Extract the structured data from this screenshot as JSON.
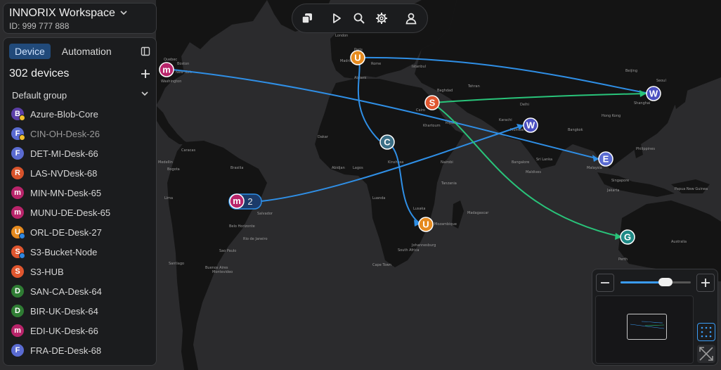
{
  "workspace": {
    "name": "INNORIX Workspace",
    "id": "ID: 999 777 888"
  },
  "tabs": {
    "device": "Device",
    "automation": "Automation"
  },
  "devices_count": "302  devices",
  "group": {
    "label": "Default group"
  },
  "devices": [
    {
      "letter": "B",
      "name": "Azure-Blob-Core",
      "color": "#5c3fa8",
      "dot": "#f2c12e",
      "dim": false
    },
    {
      "letter": "F",
      "name": "CIN-OH-Desk-26",
      "color": "#5a6bd1",
      "dot": "#f2c12e",
      "dim": true
    },
    {
      "letter": "F",
      "name": "DET-MI-Desk-66",
      "color": "#5a6bd1",
      "dot": null,
      "dim": false
    },
    {
      "letter": "R",
      "name": "LAS-NVDesk-68",
      "color": "#d8532b",
      "dot": null,
      "dim": false
    },
    {
      "letter": "m",
      "name": "MIN-MN-Desk-65",
      "color": "#b8246a",
      "dot": null,
      "dim": false
    },
    {
      "letter": "m",
      "name": "MUNU-DE-Desk-65",
      "color": "#b8246a",
      "dot": null,
      "dim": false
    },
    {
      "letter": "U",
      "name": "ORL-DE-Desk-27",
      "color": "#e58a1f",
      "dot": "#2f86e0",
      "dim": false
    },
    {
      "letter": "S",
      "name": "S3-Bucket-Node",
      "color": "#e0562f",
      "dot": "#2f86e0",
      "dim": false
    },
    {
      "letter": "S",
      "name": "S3-HUB",
      "color": "#e0562f",
      "dot": null,
      "dim": false
    },
    {
      "letter": "D",
      "name": "SAN-CA-Desk-64",
      "color": "#2f7d34",
      "dot": null,
      "dim": false
    },
    {
      "letter": "D",
      "name": "BIR-UK-Desk-64",
      "color": "#2f7d34",
      "dot": null,
      "dim": false
    },
    {
      "letter": "m",
      "name": "EDI-UK-Desk-66",
      "color": "#b8246a",
      "dot": null,
      "dim": false
    },
    {
      "letter": "F",
      "name": "FRA-DE-Desk-68",
      "color": "#5a6bd1",
      "dot": null,
      "dim": false
    }
  ],
  "toolbar": {
    "icons": [
      "layers-icon",
      "play-icon",
      "search-icon",
      "gear-icon",
      "user-icon"
    ]
  },
  "zoom": {
    "level": 0.64,
    "minus": "—",
    "plus": "+"
  },
  "map": {
    "labels": [
      {
        "text": "Quebec"
      },
      {
        "text": "Boston"
      },
      {
        "text": "New York"
      },
      {
        "text": "Washington"
      },
      {
        "text": "Caracas"
      },
      {
        "text": "Medellin"
      },
      {
        "text": "Bogota"
      },
      {
        "text": "Lima"
      },
      {
        "text": "Brasilia"
      },
      {
        "text": "Salvador"
      },
      {
        "text": "Belo Horizonte"
      },
      {
        "text": "Rio de Janeiro"
      },
      {
        "text": "Sao Paulo"
      },
      {
        "text": "Santiago"
      },
      {
        "text": "Buenos Aires"
      },
      {
        "text": "Montevideo"
      },
      {
        "text": "London"
      },
      {
        "text": "Paris"
      },
      {
        "text": "Madrid"
      },
      {
        "text": "Rome"
      },
      {
        "text": "Algiers"
      },
      {
        "text": "Istanbul"
      },
      {
        "text": "Cairo"
      },
      {
        "text": "Khartoum"
      },
      {
        "text": "Dakar"
      },
      {
        "text": "Abidjan"
      },
      {
        "text": "Lagos"
      },
      {
        "text": "Kinshasa"
      },
      {
        "text": "Luanda"
      },
      {
        "text": "Nairobi"
      },
      {
        "text": "Lusaka"
      },
      {
        "text": "Johannesburg"
      },
      {
        "text": "Cape Town"
      },
      {
        "text": "Riyadh"
      },
      {
        "text": "Tehran"
      },
      {
        "text": "Baghdad"
      },
      {
        "text": "Karachi"
      },
      {
        "text": "Mumbai"
      },
      {
        "text": "Delhi"
      },
      {
        "text": "Bangalore"
      },
      {
        "text": "Sri Lanka"
      },
      {
        "text": "Beijing"
      },
      {
        "text": "Seoul"
      },
      {
        "text": "Shanghai"
      },
      {
        "text": "Hong Kong"
      },
      {
        "text": "Bangkok"
      },
      {
        "text": "Philippines"
      },
      {
        "text": "Malaysia"
      },
      {
        "text": "Singapore"
      },
      {
        "text": "Jakarta"
      },
      {
        "text": "Papua New Guinea"
      },
      {
        "text": "Australia"
      },
      {
        "text": "Perth"
      },
      {
        "text": "Maldives"
      },
      {
        "text": "Madagascar"
      },
      {
        "text": "Mozambique"
      },
      {
        "text": "Tanzania"
      },
      {
        "text": "South Africa"
      }
    ],
    "nodes": [
      {
        "letter": "U",
        "color": "#e58a1f"
      },
      {
        "letter": "m",
        "color": "#b8246a"
      },
      {
        "letter": "S",
        "color": "#e0562f"
      },
      {
        "letter": "W",
        "color": "#4a4fc0"
      },
      {
        "letter": "W",
        "color": "#4a4fc0"
      },
      {
        "letter": "C",
        "color": "#3b6f86"
      },
      {
        "letter": "E",
        "color": "#5a6bd1"
      },
      {
        "letter": "U",
        "color": "#e58a1f"
      },
      {
        "letter": "G",
        "color": "#1f8a86"
      }
    ],
    "cluster": {
      "letter": "m",
      "count": "2",
      "color": "#b8246a"
    }
  }
}
